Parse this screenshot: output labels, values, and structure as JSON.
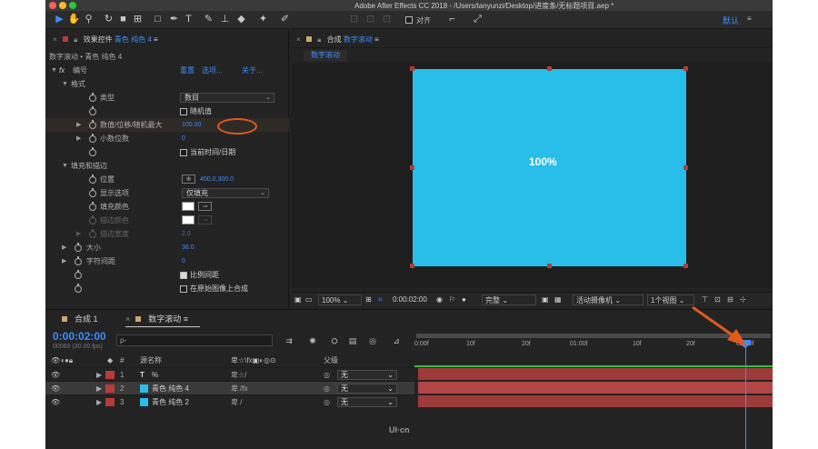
{
  "window": {
    "title": "Adobe After Effects CC 2018 - /Users/tanyunzi/Desktop/进度条/无标题项目.aep *"
  },
  "toolbar": {
    "snap_label": "对齐",
    "workspace": "默认",
    "workspace_menu": "≡"
  },
  "effects_panel": {
    "tab_prefix": "效果控件",
    "tab_layer": "青色 纯色 4",
    "tab_menu": "≡",
    "breadcrumb": "数字滚动 • 青色 纯色 4",
    "fx_label": "fx",
    "effect_name": "编号",
    "reset": "重置",
    "options": "选项...",
    "about": "关于...",
    "rows": [
      {
        "name": "格式"
      },
      {
        "name": "类型",
        "value": "数目"
      },
      {
        "name": "随机值"
      },
      {
        "name": "数值/位移/随机最大",
        "value": "100.00"
      },
      {
        "name": "小数位数",
        "value": "0"
      },
      {
        "name": "当前时间/日期"
      },
      {
        "name": "填充和描边"
      },
      {
        "name": "位置",
        "value": "400.0,300.0"
      },
      {
        "name": "显示选项",
        "value": "仅填充"
      },
      {
        "name": "填充颜色"
      },
      {
        "name": "描边颜色"
      },
      {
        "name": "描边宽度",
        "value": "2.0"
      },
      {
        "name": "大小",
        "value": "36.0"
      },
      {
        "name": "字符间距",
        "value": "0"
      },
      {
        "name": "比例间距"
      },
      {
        "name": "在原始图像上合成"
      }
    ]
  },
  "comp_panel": {
    "tab_prefix": "合成",
    "tab_name": "数字滚动",
    "tab_menu": "≡",
    "subtab": "数字滚动",
    "canvas_text": "100%",
    "canvas_color": "#29bde9",
    "zoom": "100%",
    "time": "0:00:02:00",
    "resolution": "完整",
    "camera": "活动摄像机",
    "views": "1个视图"
  },
  "timeline": {
    "tab1": "合成 1",
    "tab2": "数字滚动",
    "tab_menu": "≡",
    "timecode": "0:00:02:00",
    "frames": "00060 (30.00 fps)",
    "search_placeholder": "ρ-",
    "col_source": "源名称",
    "col_parent": "父级",
    "col_hash": "#",
    "ticks": [
      "0:00f",
      "10f",
      "20f",
      "01:00f",
      "10f",
      "20f",
      "02:00f"
    ],
    "layers": [
      {
        "idx": "1",
        "name": "%",
        "parent": "无"
      },
      {
        "idx": "2",
        "name": "青色 纯色 4",
        "parent": "无"
      },
      {
        "idx": "3",
        "name": "青色 纯色 2",
        "parent": "无"
      }
    ]
  },
  "watermark": "UI·cn"
}
